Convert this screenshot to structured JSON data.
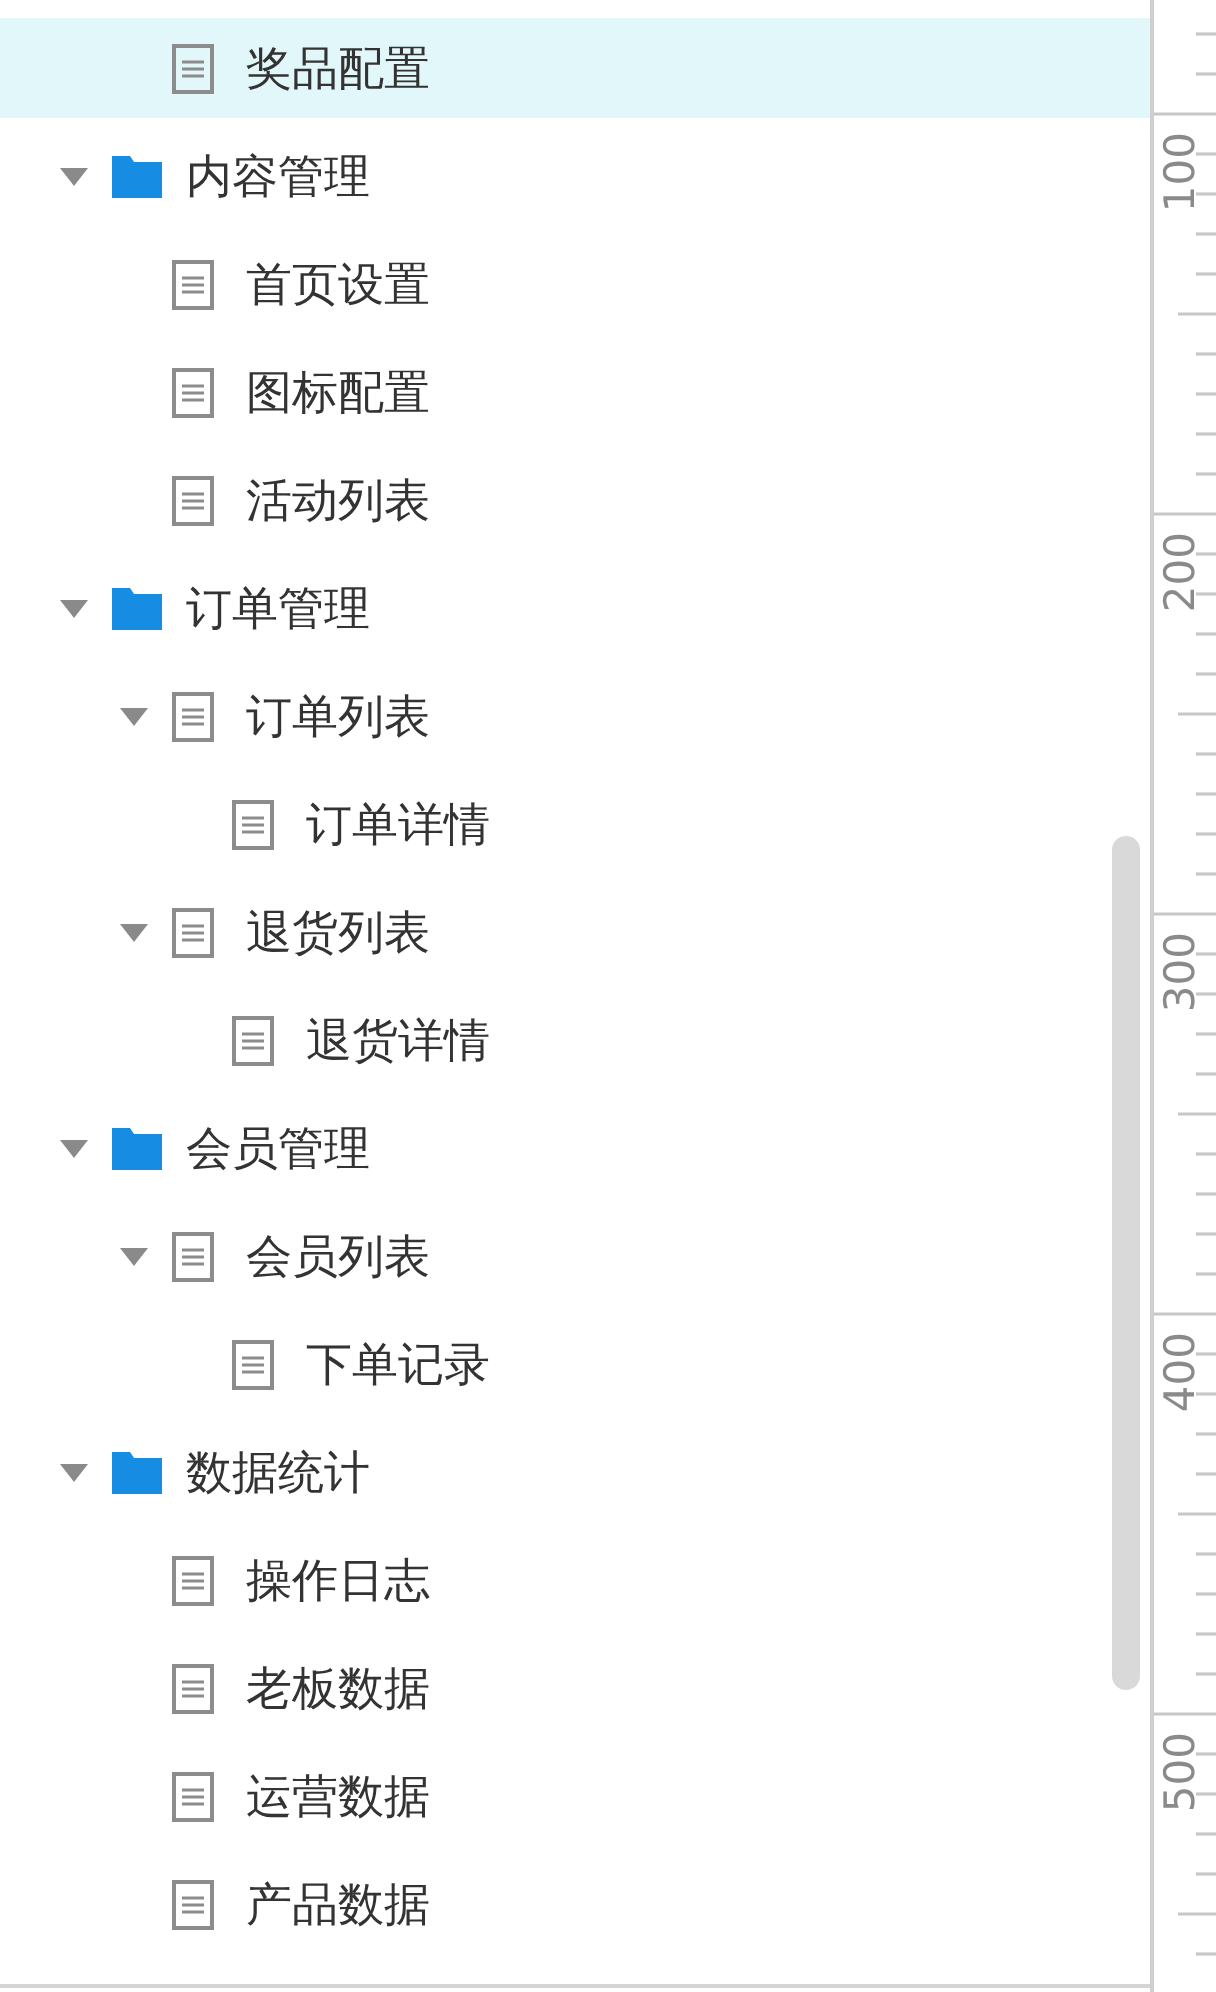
{
  "tree": [
    {
      "children": [
        {
          "kind": "page",
          "label": "奖品配置",
          "selected": true
        }
      ]
    },
    {
      "kind": "folder",
      "label": "内容管理",
      "expanded": true,
      "selected": false,
      "children": [
        {
          "kind": "page",
          "label": "首页设置",
          "selected": false
        },
        {
          "kind": "page",
          "label": "图标配置",
          "selected": false
        },
        {
          "kind": "page",
          "label": "活动列表",
          "selected": false
        }
      ]
    },
    {
      "kind": "folder",
      "label": "订单管理",
      "expanded": true,
      "selected": false,
      "children": [
        {
          "kind": "page",
          "label": "订单列表",
          "expanded": true,
          "selected": false,
          "children": [
            {
              "kind": "page",
              "label": "订单详情",
              "selected": false
            }
          ]
        },
        {
          "kind": "page",
          "label": "退货列表",
          "expanded": true,
          "selected": false,
          "children": [
            {
              "kind": "page",
              "label": "退货详情",
              "selected": false
            }
          ]
        }
      ]
    },
    {
      "kind": "folder",
      "label": "会员管理",
      "expanded": true,
      "selected": false,
      "children": [
        {
          "kind": "page",
          "label": "会员列表",
          "expanded": true,
          "selected": false,
          "children": [
            {
              "kind": "page",
              "label": "下单记录",
              "selected": false
            }
          ]
        }
      ]
    },
    {
      "kind": "folder",
      "label": "数据统计",
      "expanded": true,
      "selected": false,
      "children": [
        {
          "kind": "page",
          "label": "操作日志",
          "selected": false
        },
        {
          "kind": "page",
          "label": "老板数据",
          "selected": false
        },
        {
          "kind": "page",
          "label": "运营数据",
          "selected": false
        },
        {
          "kind": "page",
          "label": "产品数据",
          "selected": false
        }
      ]
    }
  ],
  "ruler": {
    "labels": [
      "100",
      "200",
      "300",
      "400",
      "500"
    ]
  }
}
